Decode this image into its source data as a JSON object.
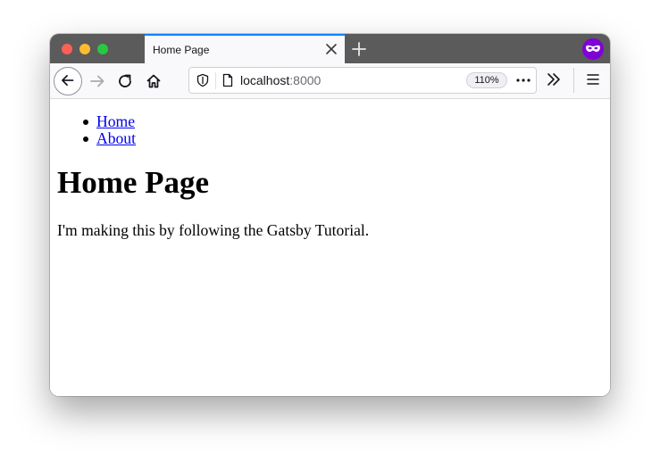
{
  "browser": {
    "tab": {
      "title": "Home Page"
    },
    "urlbar": {
      "host": "localhost",
      "port": ":8000",
      "zoom": "110%"
    },
    "icons": {
      "close": "close-icon",
      "new_tab": "plus-icon",
      "private": "private-browsing-icon",
      "back": "back-arrow-icon",
      "forward": "forward-arrow-icon",
      "reload": "reload-icon",
      "home": "home-icon",
      "shield": "shield-icon",
      "page": "page-icon",
      "page_actions": "more-horizontal-icon",
      "overflow": "chevrons-right-icon",
      "menu": "hamburger-menu-icon"
    },
    "colors": {
      "accent": "#0a84ff",
      "private": "#8000d7",
      "link": "#0000ee"
    }
  },
  "page": {
    "nav": [
      {
        "label": "Home"
      },
      {
        "label": "About"
      }
    ],
    "heading": "Home Page",
    "paragraph": "I'm making this by following the Gatsby Tutorial."
  }
}
